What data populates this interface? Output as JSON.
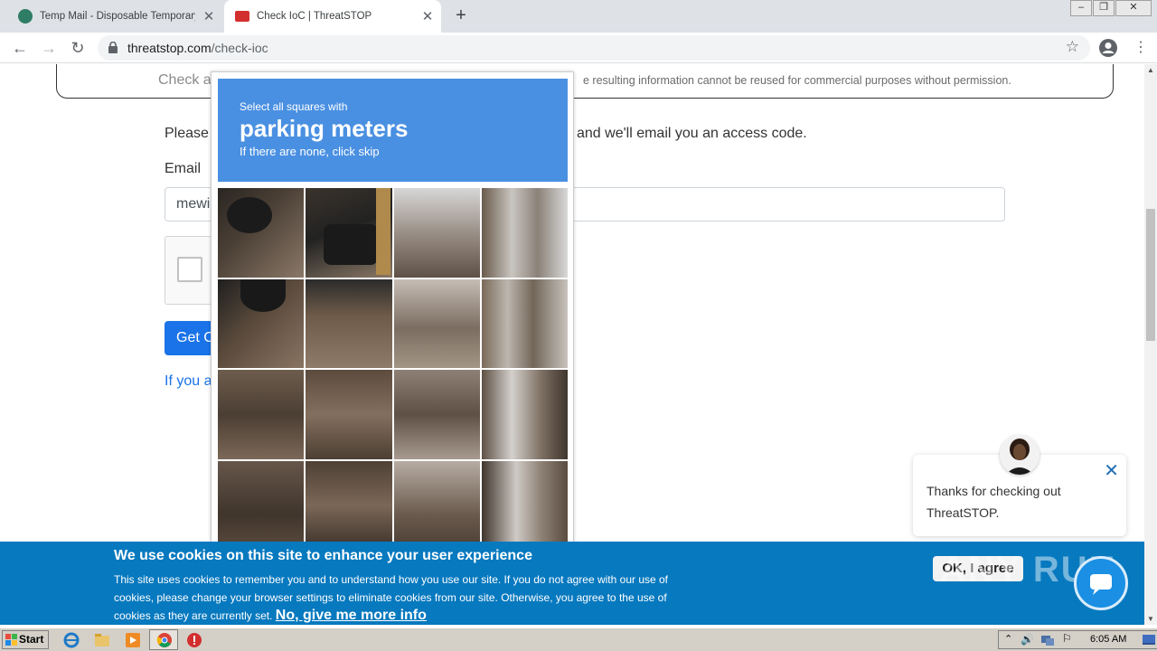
{
  "browser": {
    "tabs": [
      {
        "title": "Temp Mail - Disposable Temporary E",
        "active": false
      },
      {
        "title": "Check IoC | ThreatSTOP",
        "active": true
      }
    ],
    "url_host": "threatstop.com",
    "url_path": "/check-ioc"
  },
  "page": {
    "check_text": "Check a",
    "legal_text": "e resulting information cannot be reused for commercial purposes without permission.",
    "intro_left": "Please",
    "intro_right": "and we'll email you an access code.",
    "email_label": "Email",
    "email_value": "mewi",
    "submit_label": "Get C",
    "link_text": "If you al"
  },
  "captcha": {
    "line1": "Select all squares with",
    "line2": "parking meters",
    "line3": "If there are none, click skip"
  },
  "chat": {
    "message": "Thanks for checking out ThreatSTOP."
  },
  "cookie": {
    "title": "We use cookies on this site to enhance your user experience",
    "body": "This site uses cookies to remember you and to understand how you use our site. If you do not agree with our use of cookies, please change your browser settings to eliminate cookies from our site. Otherwise, you agree to the use of cookies as they are currently set.",
    "more_link": "No, give me more info",
    "ok_label": "OK, I agree"
  },
  "watermark": "ANY RUN",
  "taskbar": {
    "start_label": "Start",
    "clock": "6:05 AM"
  },
  "colors": {
    "cookie_bg": "#0779bf",
    "captcha_header": "#4a90e2",
    "primary": "#1a73e8"
  }
}
